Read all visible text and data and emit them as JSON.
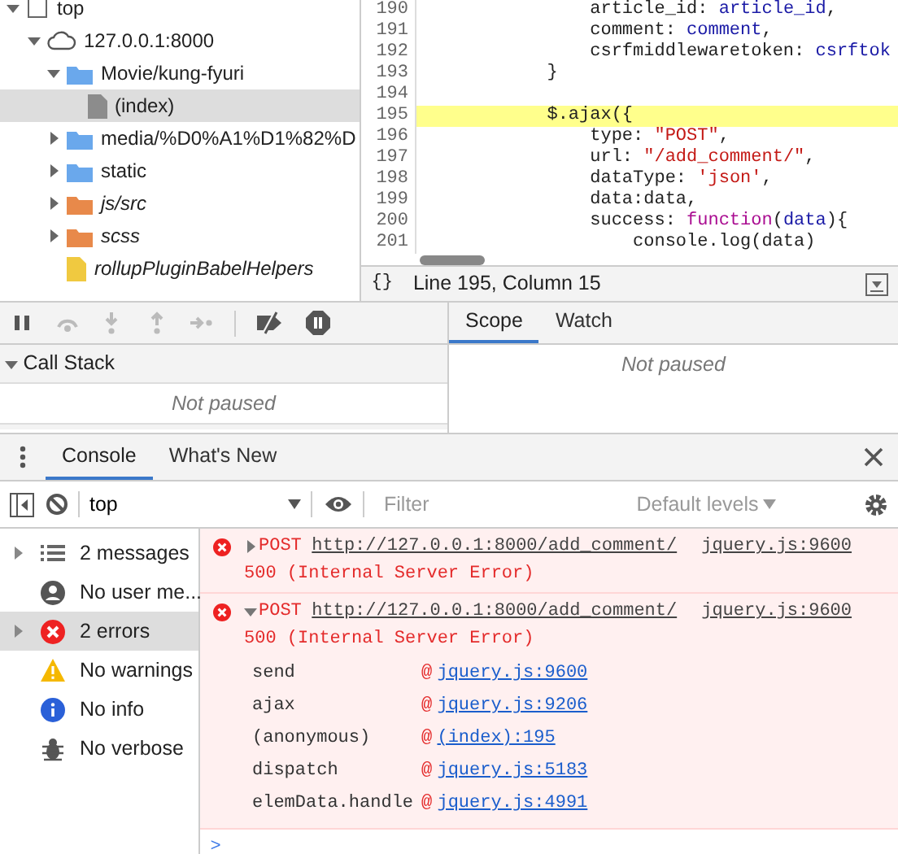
{
  "navigator": {
    "tree": [
      {
        "label": "top",
        "kind": "frame",
        "expanded": true,
        "selected": false,
        "italic": false,
        "children": [
          {
            "label": "127.0.0.1:8000",
            "kind": "domain",
            "expanded": true,
            "selected": false,
            "italic": false,
            "children": [
              {
                "label": "Movie/kung-fyuri",
                "kind": "folder",
                "color": "#6aa8ec",
                "expanded": true,
                "selected": false,
                "italic": false,
                "children": [
                  {
                    "label": "(index)",
                    "kind": "file",
                    "color": "#8c8c8c",
                    "selected": true,
                    "italic": false
                  }
                ]
              },
              {
                "label": "media/%D0%A1%D1%82%D",
                "kind": "folder",
                "color": "#6aa8ec",
                "expanded": false,
                "selected": false,
                "italic": false
              },
              {
                "label": "static",
                "kind": "folder",
                "color": "#6aa8ec",
                "expanded": false,
                "selected": false,
                "italic": false
              },
              {
                "label": "js/src",
                "kind": "folder",
                "color": "#e8894a",
                "expanded": false,
                "selected": false,
                "italic": true
              },
              {
                "label": "scss",
                "kind": "folder",
                "color": "#e8894a",
                "expanded": false,
                "selected": false,
                "italic": true
              },
              {
                "label": "rollupPluginBabelHelpers",
                "kind": "file",
                "color": "#f0c940",
                "selected": false,
                "italic": true
              }
            ]
          }
        ]
      }
    ]
  },
  "editor": {
    "lines": [
      {
        "number": "190",
        "highlighted": false,
        "tokens": [
          {
            "text": "                article_id: ",
            "kind": "plain"
          },
          {
            "text": "article_id",
            "kind": "variable"
          },
          {
            "text": ",",
            "kind": "plain"
          }
        ]
      },
      {
        "number": "191",
        "highlighted": false,
        "tokens": [
          {
            "text": "                comment: ",
            "kind": "plain"
          },
          {
            "text": "comment",
            "kind": "variable"
          },
          {
            "text": ",",
            "kind": "plain"
          }
        ]
      },
      {
        "number": "192",
        "highlighted": false,
        "tokens": [
          {
            "text": "                csrfmiddlewaretoken: ",
            "kind": "plain"
          },
          {
            "text": "csrftok",
            "kind": "variable"
          }
        ]
      },
      {
        "number": "193",
        "highlighted": false,
        "tokens": [
          {
            "text": "            }",
            "kind": "plain"
          }
        ]
      },
      {
        "number": "194",
        "highlighted": false
      },
      {
        "number": "195",
        "highlighted": true,
        "tokens": [
          {
            "text": "            $.ajax({",
            "kind": "plain"
          }
        ]
      },
      {
        "number": "196",
        "highlighted": false,
        "tokens": [
          {
            "text": "                type: ",
            "kind": "plain"
          },
          {
            "text": "\"POST\"",
            "kind": "string"
          },
          {
            "text": ",",
            "kind": "plain"
          }
        ]
      },
      {
        "number": "197",
        "highlighted": false,
        "tokens": [
          {
            "text": "                url: ",
            "kind": "plain"
          },
          {
            "text": "\"/add_comment/\"",
            "kind": "string"
          },
          {
            "text": ",",
            "kind": "plain"
          }
        ]
      },
      {
        "number": "198",
        "highlighted": false,
        "tokens": [
          {
            "text": "                dataType: ",
            "kind": "plain"
          },
          {
            "text": "'json'",
            "kind": "string"
          },
          {
            "text": ",",
            "kind": "plain"
          }
        ]
      },
      {
        "number": "199",
        "highlighted": false,
        "tokens": [
          {
            "text": "                data:data,",
            "kind": "plain"
          }
        ]
      },
      {
        "number": "200",
        "highlighted": false,
        "tokens": [
          {
            "text": "                success: ",
            "kind": "plain"
          },
          {
            "text": "function",
            "kind": "keyword"
          },
          {
            "text": "(",
            "kind": "plain"
          },
          {
            "text": "data",
            "kind": "variable"
          },
          {
            "text": "){",
            "kind": "plain"
          }
        ]
      },
      {
        "number": "201",
        "highlighted": false,
        "tokens": [
          {
            "text": "                    console.log(data)",
            "kind": "plain"
          }
        ]
      }
    ],
    "format_symbol": "{}",
    "status": "Line 195, Column 15"
  },
  "debugger": {
    "call_stack": {
      "title": "Call Stack",
      "expanded": true,
      "message": "Not paused"
    },
    "tabs": [
      {
        "label": "Scope",
        "selected": true
      },
      {
        "label": "Watch",
        "selected": false
      }
    ],
    "scope_message": "Not paused"
  },
  "drawer": {
    "tabs": [
      {
        "label": "Console",
        "selected": true
      },
      {
        "label": "What's New",
        "selected": false
      }
    ]
  },
  "console": {
    "context": "top",
    "filter": {
      "placeholder": "Filter"
    },
    "levels": "Default levels",
    "sidebar": [
      {
        "label": "2 messages",
        "kind": "messages",
        "expanded": false,
        "selected": false
      },
      {
        "label": "No user me...",
        "kind": "user",
        "selected": false
      },
      {
        "label": "2 errors",
        "kind": "error",
        "expanded": false,
        "selected": true
      },
      {
        "label": "No warnings",
        "kind": "warning",
        "selected": false
      },
      {
        "label": "No info",
        "kind": "info",
        "selected": false
      },
      {
        "label": "No verbose",
        "kind": "verbose",
        "selected": false
      }
    ],
    "messages": [
      {
        "method": "POST",
        "url": "http://127.0.0.1:8000/add_comment/",
        "source": "jquery.js:9600",
        "status": "500 (Internal Server Error)",
        "expanded": false
      },
      {
        "method": "POST",
        "url": "http://127.0.0.1:8000/add_comment/",
        "source": "jquery.js:9600",
        "status": "500 (Internal Server Error)",
        "expanded": true,
        "stack": [
          {
            "function": "send",
            "at": "@",
            "location": "jquery.js:9600"
          },
          {
            "function": "ajax",
            "at": "@",
            "location": "jquery.js:9206"
          },
          {
            "function": "(anonymous)",
            "at": "@",
            "location": "(index):195"
          },
          {
            "function": "dispatch",
            "at": "@",
            "location": "jquery.js:5183"
          },
          {
            "function": "elemData.handle",
            "at": "@",
            "location": "jquery.js:4991"
          }
        ]
      }
    ],
    "prompt": ">"
  }
}
